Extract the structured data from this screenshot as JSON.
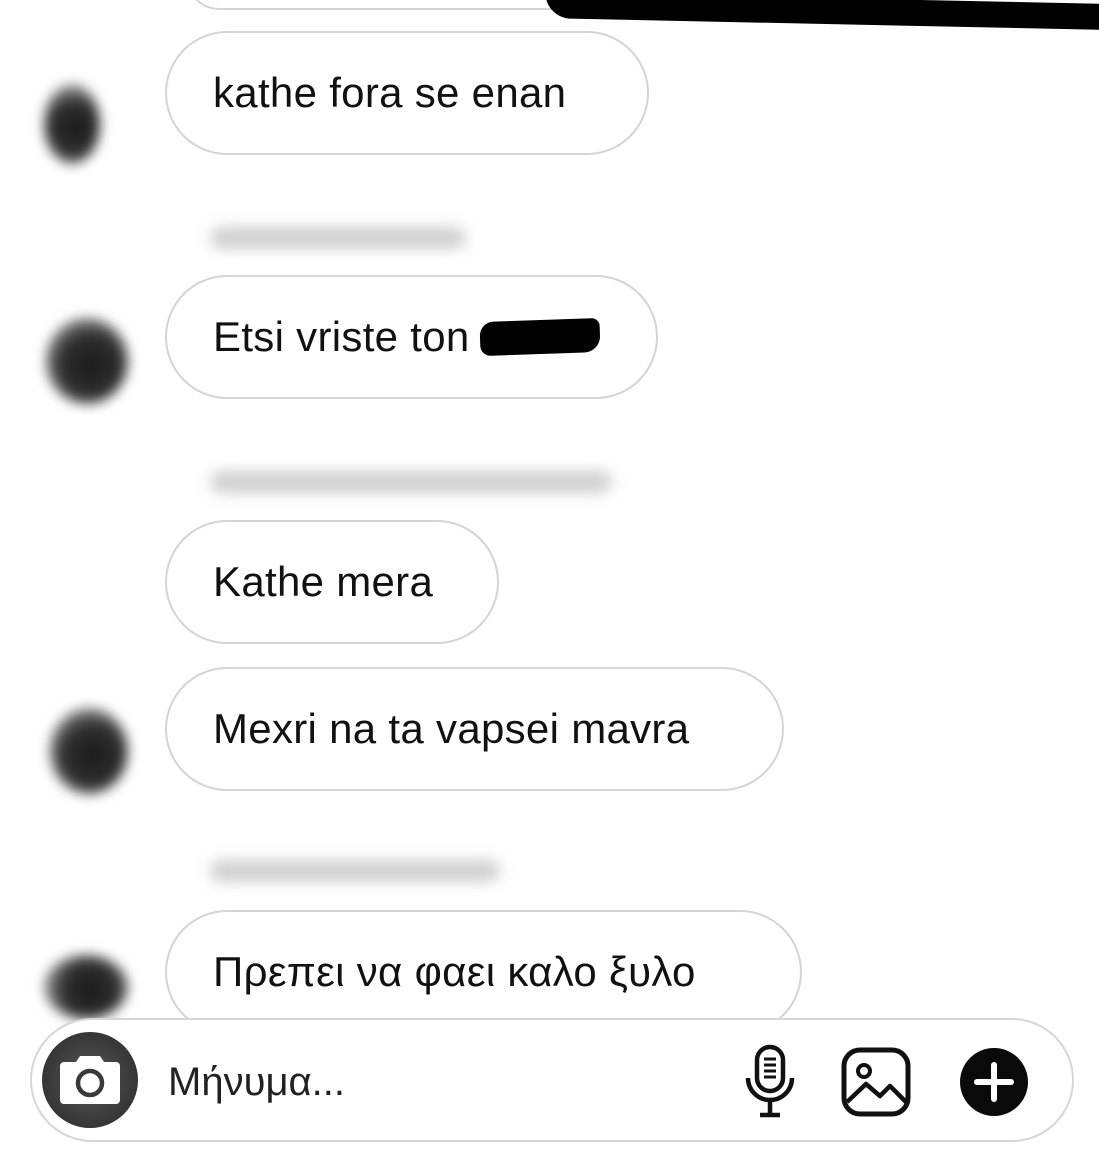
{
  "messages": [
    {
      "text": "kathe fora se enan"
    },
    {
      "text": "Etsi vriste ton"
    },
    {
      "text": "Kathe mera"
    },
    {
      "text": "Mexri na ta vapsei mavra"
    },
    {
      "text": "Πρεπει να φαει καλο ξυλο"
    }
  ],
  "composer": {
    "placeholder": "Μήνυμα..."
  },
  "icons": {
    "camera": "camera-icon",
    "microphone": "microphone-icon",
    "gallery": "image-icon",
    "add": "plus-circle-icon"
  }
}
